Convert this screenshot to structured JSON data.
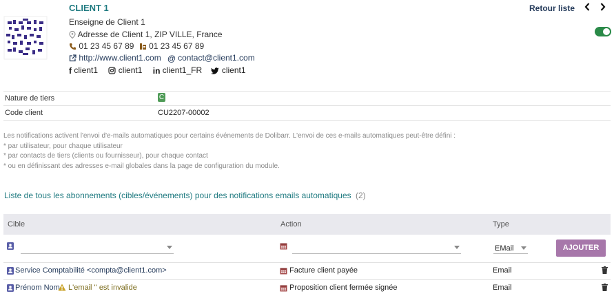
{
  "header": {
    "client_name": "CLIENT 1",
    "enseigne": "Enseigne de Client 1",
    "address": "Adresse de Client 1, ZIP VILLE, France",
    "phone": "01 23 45 67 89",
    "fax": "01 23 45 67 89",
    "website": "http://www.client1.com",
    "email": "contact@client1.com",
    "facebook": "client1",
    "instagram": "client1",
    "linkedin": "client1_FR",
    "twitter": "client1",
    "back_link": "Retour liste",
    "prev": "<",
    "next": ">"
  },
  "fields": {
    "nature_label": "Nature de tiers",
    "nature_badge": "C",
    "code_label": "Code client",
    "code_value": "CU2207-00002"
  },
  "notice": {
    "line1": "Les notifications activent l'envoi d'e-mails automatiques pour certains événements de Dolibarr. L'envoi de ces e-mails automatiques peut-être défini :",
    "line2": "* par utilisateur, pour chaque utilisateur",
    "line3": "* par contacts de tiers (clients ou fournisseur), pour chaque contact",
    "line4": "* ou en définissant des adresses e-mail globales dans la page de configuration du module."
  },
  "list": {
    "title": "Liste de tous les abonnements (cibles/événements) pour des notifications emails automatiques",
    "count": "(2)",
    "columns": {
      "cible": "Cible",
      "action": "Action",
      "type": "Type"
    },
    "form": {
      "type_value": "EMail",
      "add_button": "AJOUTER"
    },
    "rows": [
      {
        "cible": "Service Comptabilité <compta@client1.com>",
        "warning": "",
        "action": "Facture client payée",
        "type": "Email"
      },
      {
        "cible": "Prénom Nom",
        "warning": "L'email '' est invalide",
        "action": "Proposition client fermée signée",
        "type": "Email"
      }
    ]
  },
  "colors": {
    "accent": "#1f7a80",
    "toggle": "#2a8a48",
    "button": "#a777aa",
    "badge": "#4f9b57",
    "table_header": "#e9e9ee"
  }
}
